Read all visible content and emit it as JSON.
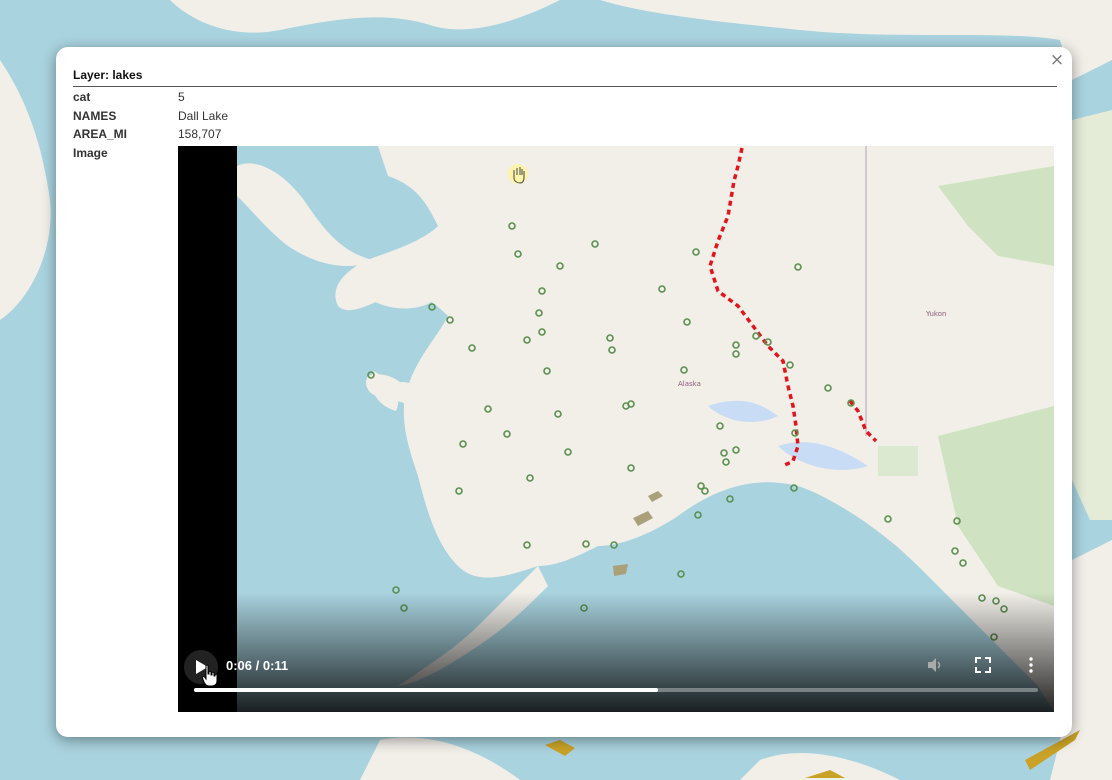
{
  "popup": {
    "layer_title": "Layer: lakes",
    "close_label": "×",
    "attributes": [
      {
        "key": "cat",
        "value": "5"
      },
      {
        "key": "NAMES",
        "value": "Dall Lake"
      },
      {
        "key": "AREA_MI",
        "value": "158,707"
      },
      {
        "key": "Image",
        "value": ""
      }
    ]
  },
  "video": {
    "time_display": "0:06 / 0:11",
    "progress_fraction": 0.55,
    "map_label": "Alaska",
    "map_label_yukon": "Yukon",
    "icons": [
      "play-icon",
      "volume-icon",
      "fullscreen-icon",
      "more-options-icon",
      "hand-cursor-icon"
    ]
  },
  "colors": {
    "water": "#a9d3df",
    "land": "#f2efe9",
    "route": "#e3141c",
    "marker": "#5a8f4e",
    "lake_fill": "#aaa07a"
  }
}
